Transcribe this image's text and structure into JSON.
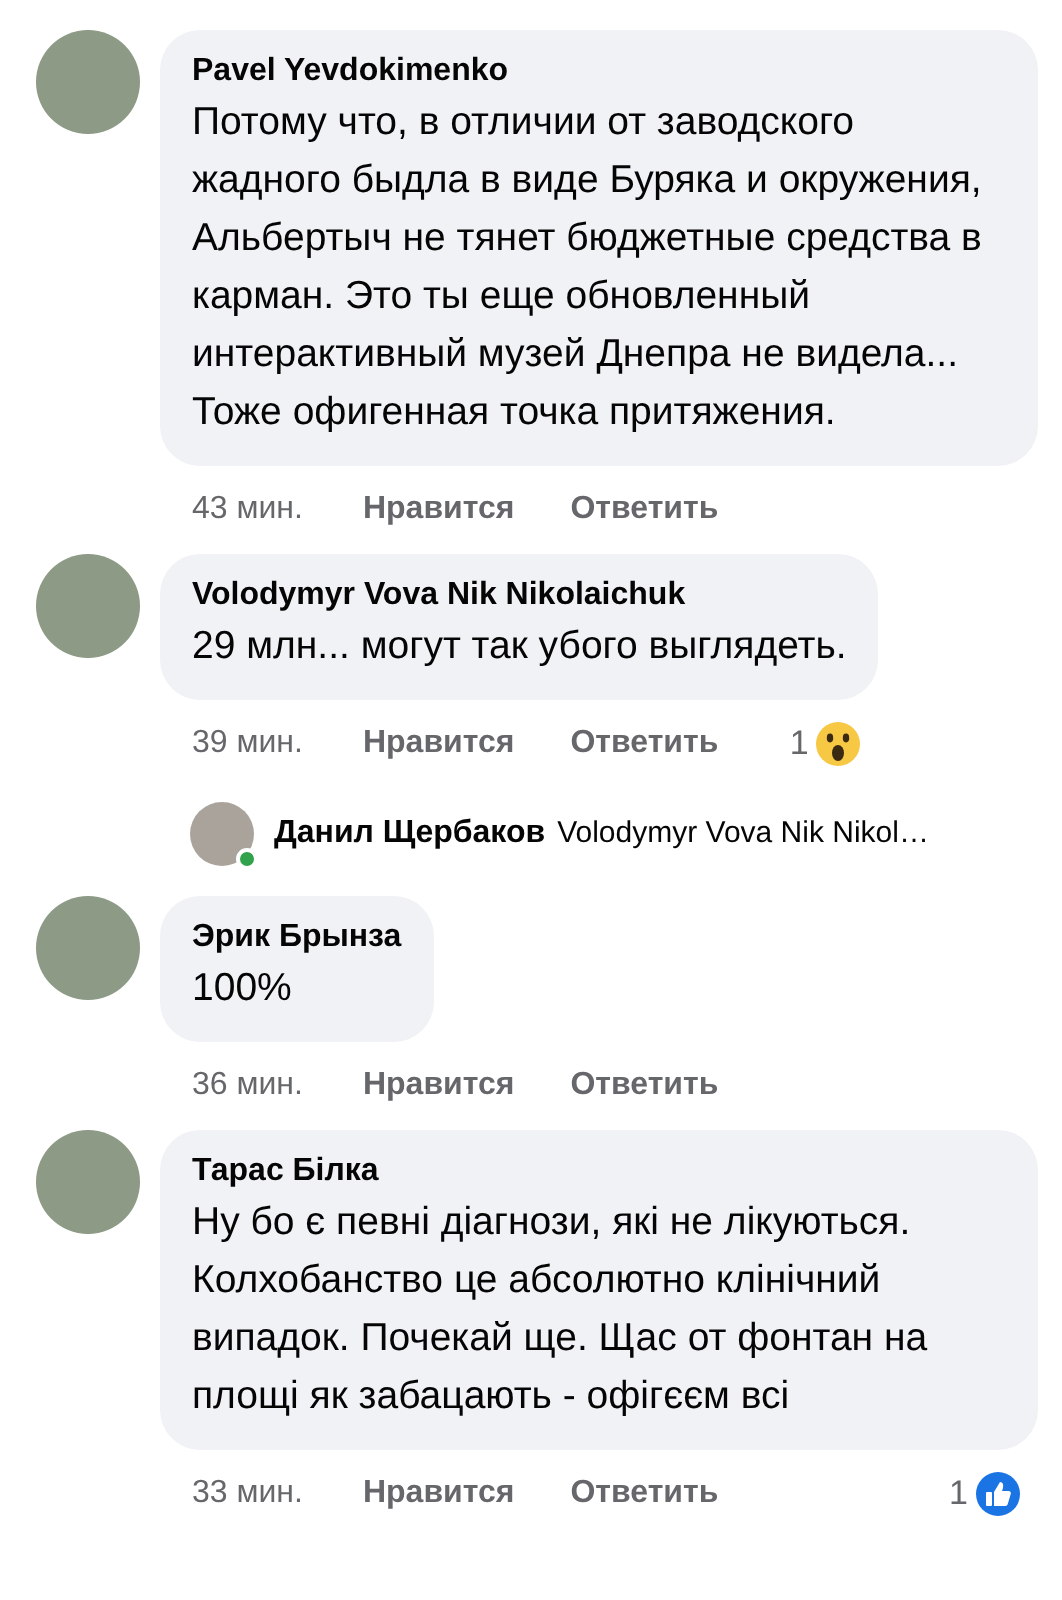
{
  "comments": [
    {
      "author": "Pavel Yevdokimenko",
      "text": "Потому что, в отличии от заводского жадного быдла в виде Буряка и окружения, Альбертыч не тянет бюджетные средства в карман. Это ты еще обновленный интерактивный музей Днепра не видела... Тоже офигенная точка притяжения.",
      "time": "43 мин.",
      "like": "Нравится",
      "reply": "Ответить"
    },
    {
      "author": "Volodymyr Vova Nik Nikolaichuk",
      "text": "29 млн... могут так убого выглядеть.",
      "time": "39 мин.",
      "like": "Нравится",
      "reply": "Ответить",
      "reaction": {
        "kind": "wow",
        "count": "1"
      },
      "reply_preview": {
        "author": "Данил Щербаков",
        "text": "Volodymyr Vova Nik Nikol…",
        "online": true
      }
    },
    {
      "author": "Эрик Брынза",
      "text": "100%",
      "time": "36 мин.",
      "like": "Нравится",
      "reply": "Ответить"
    },
    {
      "author": "Тарас Білка",
      "text": "Ну бо є певні діагнози, які не лікуються. Колхобанство це абсолютно клінічний випадок. Почекай ще. Щас от фонтан на площі як забацають - офігєєм всі",
      "time": "33 мин.",
      "like": "Нравится",
      "reply": "Ответить",
      "reaction": {
        "kind": "like",
        "count": "1"
      }
    }
  ]
}
